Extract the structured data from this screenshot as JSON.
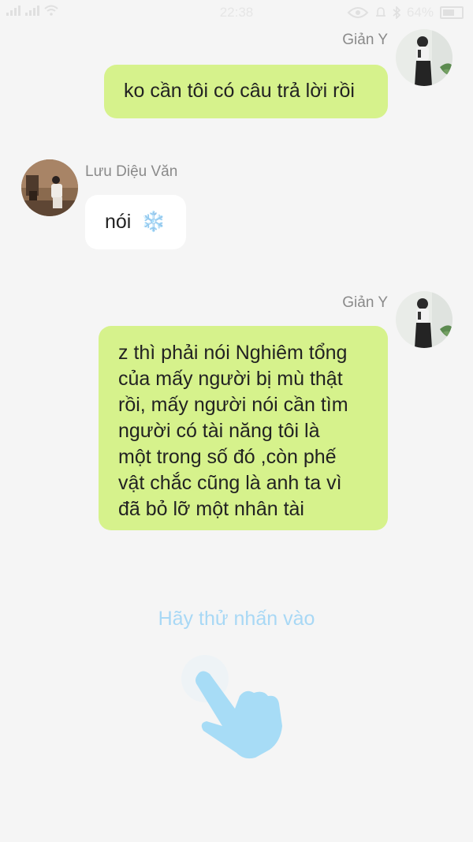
{
  "status_bar": {
    "time": "22:38",
    "battery": "64%"
  },
  "messages": [
    {
      "side": "right",
      "sender": "Giản Y",
      "text": "ko cần tôi có câu trả lời rồi"
    },
    {
      "side": "left",
      "sender": "Lưu Diệu Văn",
      "text": "nói",
      "emoji": "❄️"
    },
    {
      "side": "right",
      "sender": "Giản Y",
      "text_lines": [
        "z thì phải nói Nghiêm tổng",
        "của mấy người bị mù thật",
        "rồi, mấy người nói cần tìm",
        "người có tài năng tôi là",
        "một trong số đó ,còn phế",
        "vật chắc cũng là anh ta vì",
        "đã bỏ lỡ một nhân tài"
      ]
    }
  ],
  "hint": {
    "text": "Hãy thử nhấn vào"
  },
  "colors": {
    "background": "#f5f5f5",
    "bubble_right": "#d6f28c",
    "bubble_left": "#ffffff",
    "hint": "#a8d8f5"
  }
}
